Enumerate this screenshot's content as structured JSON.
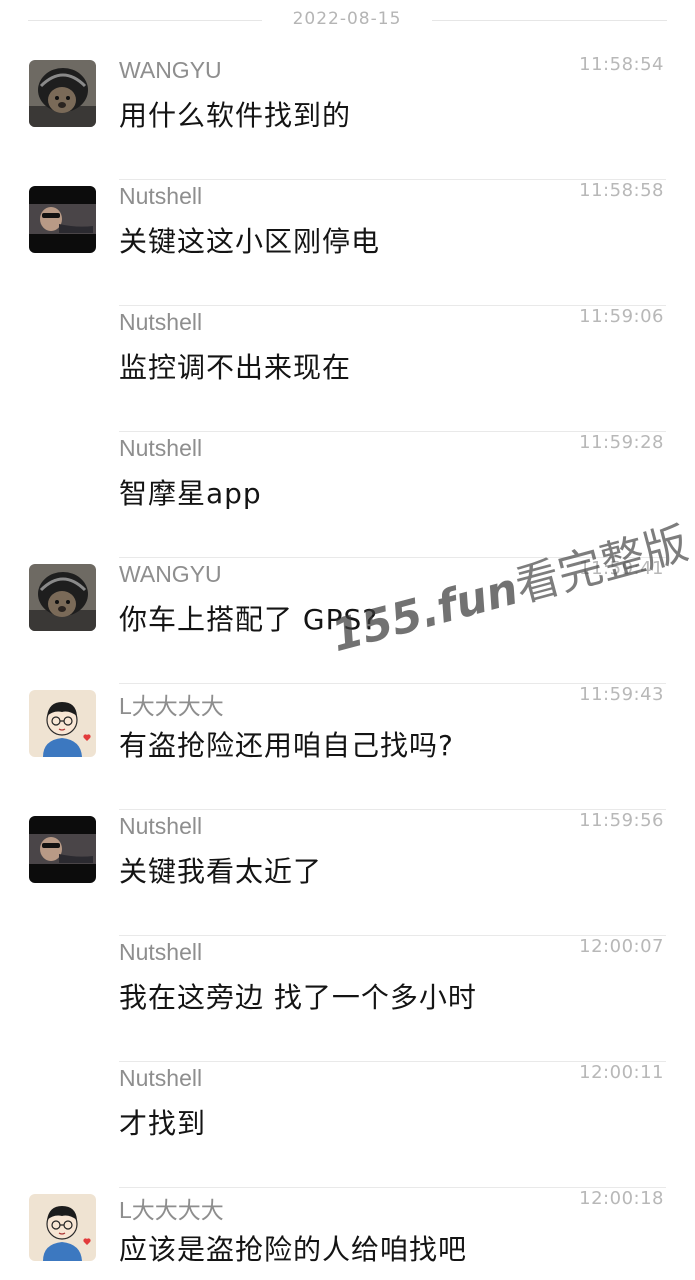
{
  "date_separator": "2022-08-15",
  "messages": [
    {
      "sender": "WANGYU",
      "time": "11:58:54",
      "text": "用什么软件找到的"
    },
    {
      "sender": "Nutshell",
      "time": "11:58:58",
      "text": "关键这这小区刚停电"
    },
    {
      "sender": "Nutshell",
      "time": "11:59:06",
      "text": "监控调不出来现在"
    },
    {
      "sender": "Nutshell",
      "time": "11:59:28",
      "text": "智摩星app"
    },
    {
      "sender": "WANGYU",
      "time": "11:59:41",
      "text": "你车上搭配了 GPS?"
    },
    {
      "sender": "L大大大大",
      "time": "11:59:43",
      "text": "有盗抢险还用咱自己找吗?"
    },
    {
      "sender": "Nutshell",
      "time": "11:59:56",
      "text": "关键我看太近了"
    },
    {
      "sender": "Nutshell",
      "time": "12:00:07",
      "text": "我在这旁边 找了一个多小时"
    },
    {
      "sender": "Nutshell",
      "time": "12:00:11",
      "text": "才找到"
    },
    {
      "sender": "L大大大大",
      "time": "12:00:18",
      "text": "应该是盗抢险的人给咱找吧"
    }
  ],
  "watermark": {
    "prefix": "155.fun",
    "suffix": "看完整版"
  }
}
